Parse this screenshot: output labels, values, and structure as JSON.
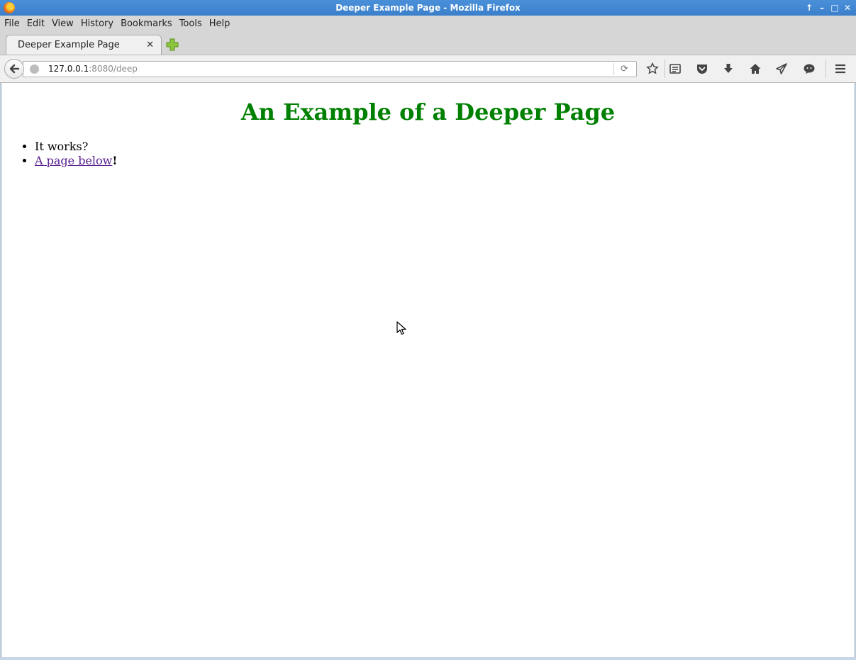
{
  "window": {
    "title": "Deeper Example Page - Mozilla Firefox"
  },
  "menu": [
    "File",
    "Edit",
    "View",
    "History",
    "Bookmarks",
    "Tools",
    "Help"
  ],
  "tab": {
    "label": "Deeper Example Page",
    "close_glyph": "✕"
  },
  "urlbar": {
    "host": "127.0.0.1",
    "rest": ":8080/deep"
  },
  "toolbar_icons": [
    "bookmark-star-icon",
    "reading-list-icon",
    "pocket-icon",
    "download-icon",
    "home-icon",
    "send-icon",
    "chat-icon",
    "hamburger-menu-icon"
  ],
  "page": {
    "heading": "An Example of a Deeper Page",
    "items": [
      {
        "text": "It works?"
      },
      {
        "link_text": "A page below",
        "suffix": "!"
      }
    ]
  }
}
